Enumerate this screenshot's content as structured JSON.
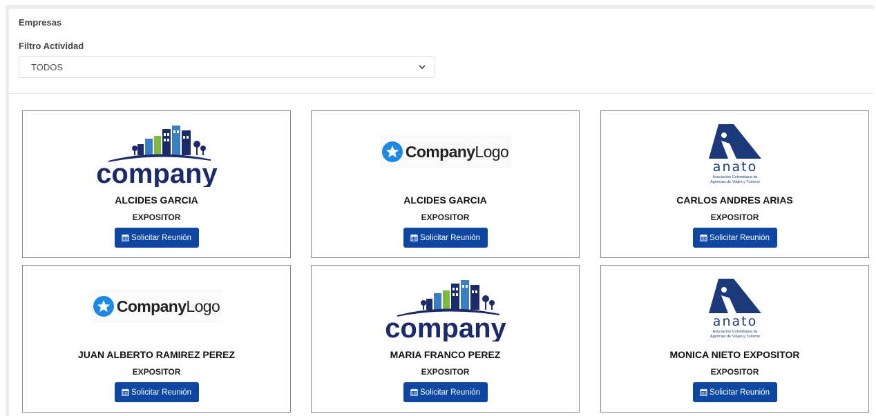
{
  "header": {
    "section_title": "Empresas",
    "filter_label": "Filtro Actividad",
    "filter_selected": "TODOS"
  },
  "cards": [
    {
      "logo": "company-buildings-logo",
      "name": "ALCIDES GARCIA",
      "role": "EXPOSITOR",
      "button": "Solicitar Reunión"
    },
    {
      "logo": "companylogo-star-logo",
      "name": "ALCIDES GARCIA",
      "role": "EXPOSITOR",
      "button": "Solicitar Reunión"
    },
    {
      "logo": "anato-logo",
      "name": "CARLOS ANDRES ARIAS",
      "role": "EXPOSITOR",
      "button": "Solicitar Reunión"
    },
    {
      "logo": "companylogo-star-logo",
      "name": "JUAN ALBERTO RAMIREZ PEREZ",
      "role": "EXPOSITOR",
      "button": "Solicitar Reunión"
    },
    {
      "logo": "company-buildings-logo",
      "name": "MARIA FRANCO PEREZ",
      "role": "EXPOSITOR",
      "button": "Solicitar Reunión"
    },
    {
      "logo": "anato-logo",
      "name": "MONICA NIETO EXPOSITOR",
      "role": "EXPOSITOR",
      "button": "Solicitar Reunión"
    }
  ],
  "logos": {
    "company": {
      "word": "company"
    },
    "companylogo": {
      "bold": "Company",
      "light": "Logo"
    },
    "anato": {
      "word": "anato",
      "line1": "Asociación Colombiana de",
      "line2": "Agencias de Viajes y Turismo"
    }
  },
  "colors": {
    "button_bg": "#0d47a1",
    "company_navy": "#1b2a6b",
    "company_green": "#7dbb3a",
    "company_blue": "#3a7fc1",
    "anato_navy": "#1c3a7a",
    "star_blue": "#1e88e5"
  }
}
